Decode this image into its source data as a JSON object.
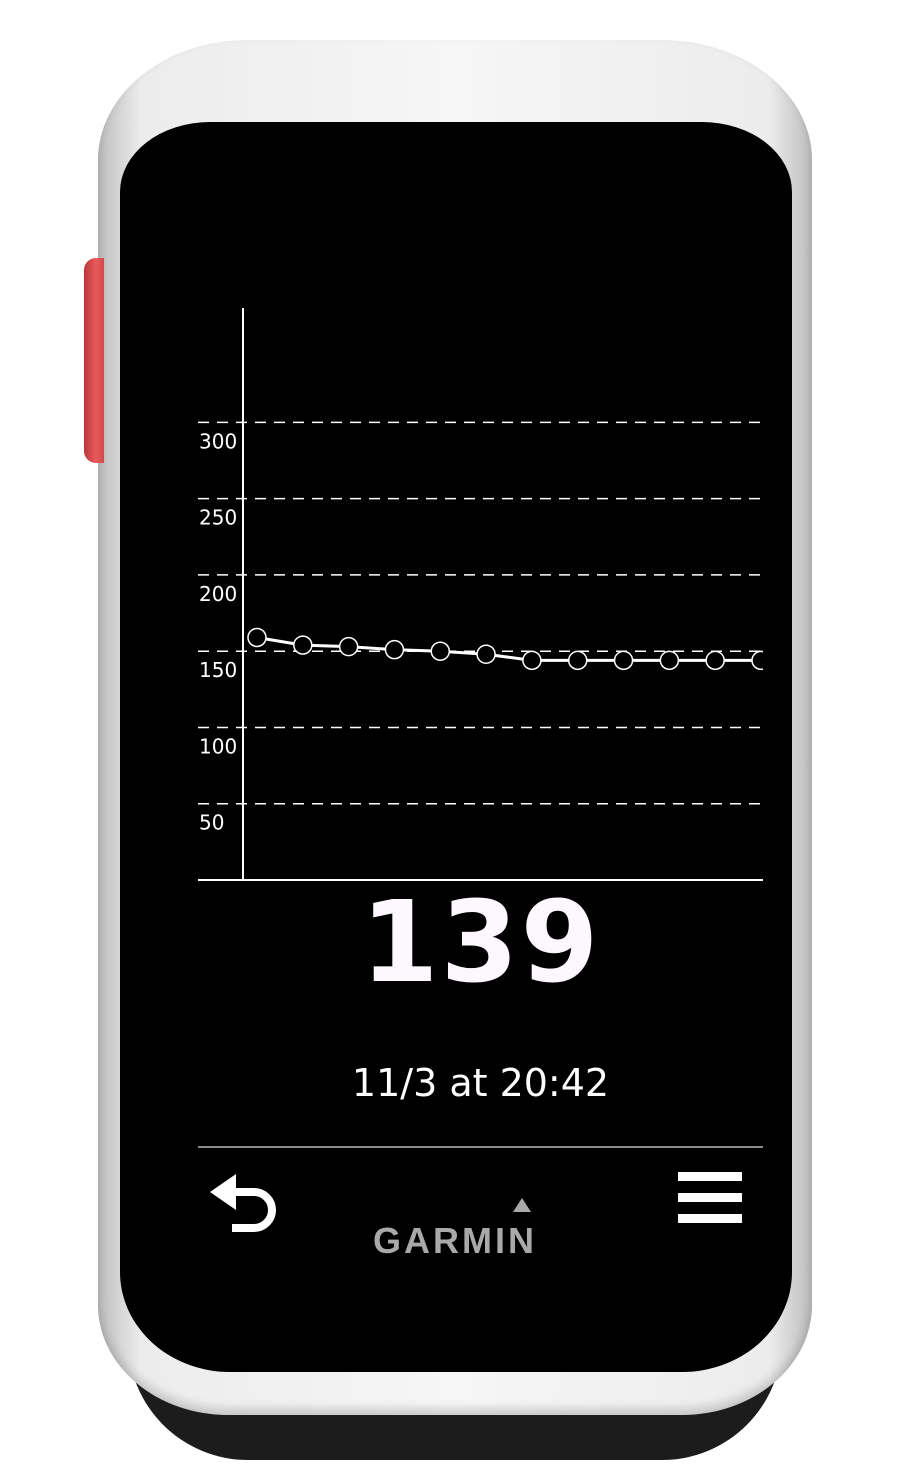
{
  "device": {
    "brand": "GARMIN"
  },
  "chart_data": {
    "type": "line",
    "title": "",
    "xlabel": "",
    "ylabel": "",
    "y_ticks": [
      "50",
      "100",
      "150",
      "200",
      "250",
      "300"
    ],
    "ylim": [
      0,
      375
    ],
    "grid": true,
    "marker": "open-circle",
    "series": [
      {
        "values": [
          159,
          154,
          153,
          151,
          150,
          148,
          144,
          144,
          144,
          144,
          144,
          144
        ]
      }
    ]
  },
  "reading": {
    "value": "139",
    "timestamp": "11/3 at 20:42"
  },
  "colors": {
    "screen_background": "#000000",
    "line": "#ffffff",
    "side_button": "#e24b4d",
    "brand_text": "#a9a9a9"
  },
  "icons": {
    "back": "back-arrow-icon",
    "menu": "hamburger-menu-icon"
  }
}
